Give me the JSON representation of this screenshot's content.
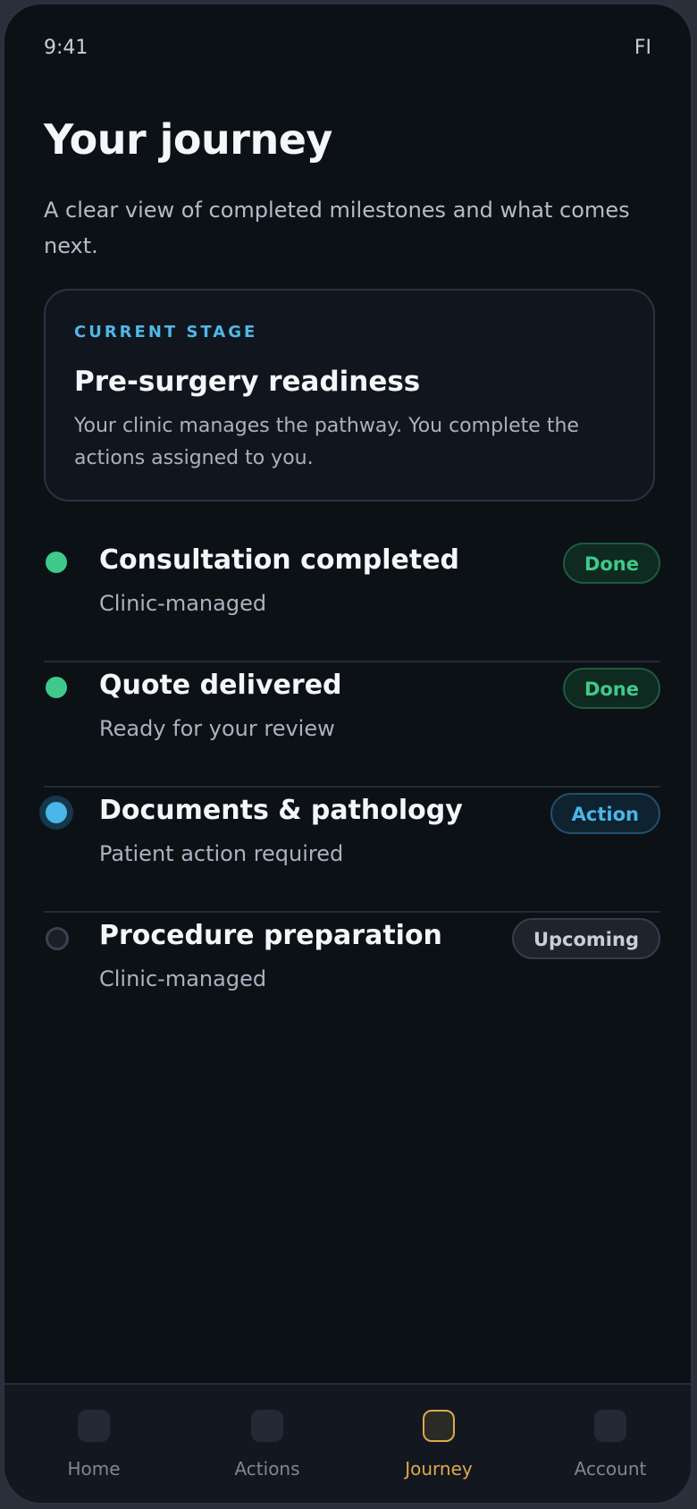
{
  "status_bar": {
    "time": "9:41",
    "right_text": "FI"
  },
  "header": {
    "title": "Your journey",
    "subtitle": "A clear view of completed milestones and what comes next."
  },
  "current_stage": {
    "label": "CURRENT STAGE",
    "title": "Pre-surgery readiness",
    "description": "Your clinic manages the pathway. You complete the actions assigned to you."
  },
  "milestones": [
    {
      "title": "Consultation completed",
      "subtitle": "Clinic-managed",
      "status": "done",
      "badge": "Done"
    },
    {
      "title": "Quote delivered",
      "subtitle": "Ready for your review",
      "status": "done",
      "badge": "Done"
    },
    {
      "title": "Documents & pathology",
      "subtitle": "Patient action required",
      "status": "action",
      "badge": "Action"
    },
    {
      "title": "Procedure preparation",
      "subtitle": "Clinic-managed",
      "status": "upcoming",
      "badge": "Upcoming"
    }
  ],
  "bottom_nav": {
    "items": [
      {
        "label": "Home",
        "icon": "home-icon"
      },
      {
        "label": "Actions",
        "icon": "actions-icon"
      },
      {
        "label": "Journey",
        "icon": "journey-icon",
        "active": true
      },
      {
        "label": "Account",
        "icon": "account-icon"
      }
    ]
  },
  "colors": {
    "background": "#0c1116",
    "done": "#3fc98a",
    "action": "#4ab6e8",
    "accent": "#e0a94a"
  }
}
